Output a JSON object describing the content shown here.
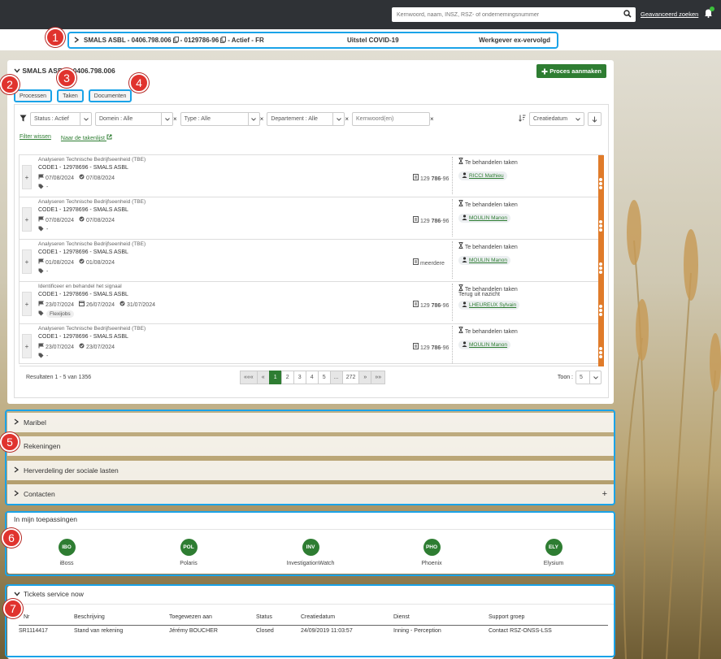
{
  "topbar": {
    "search_placeholder": "Kernwoord, naam, INSZ, RSZ- of ondernemingsnummer",
    "advanced_search": "Geavanceerd zoeken"
  },
  "context": {
    "company": "SMALS ASBL - 0406.798.006",
    "number": "- 0129786-96",
    "state": "- Actief - FR",
    "middle": "Uitstel COVID-19",
    "right": "Werkgever ex-vervolgd"
  },
  "main": {
    "title": "SMALS ASBL - 0406.798.006",
    "create_button": "Proces aanmaken",
    "tabs": [
      {
        "label": "Processen"
      },
      {
        "label": "Taken"
      },
      {
        "label": "Documenten"
      }
    ],
    "filters": {
      "status": "Status : Actief",
      "domain": "Domein : Alle",
      "type": "Type : Alle",
      "department": "Departement : Alle",
      "keyword_placeholder": "Kernwoord(en)",
      "sort": "Creatiedatum"
    },
    "links": {
      "clear": "Filter wissen",
      "tasklist": "Naar de takenlijst"
    },
    "rows": [
      {
        "category": "Analyseren Technische Bedrijfseenheid (TBE)",
        "code": "CODE1 - 12978696 - SMALS ASBL",
        "d1": "07/08/2024",
        "d2": "",
        "d3": "07/08/2024",
        "tag": "-",
        "ref_pre": "129",
        "ref_bold": "786",
        "ref_post": "-96",
        "status": "Te behandelen taken",
        "status2": "",
        "person": "RICCI Mathieu"
      },
      {
        "category": "Analyseren Technische Bedrijfseenheid (TBE)",
        "code": "CODE1 - 12978696 - SMALS ASBL",
        "d1": "07/08/2024",
        "d2": "",
        "d3": "07/08/2024",
        "tag": "-",
        "ref_pre": "129",
        "ref_bold": "786",
        "ref_post": "-96",
        "status": "Te behandelen taken",
        "status2": "",
        "person": "MOULIN Manon"
      },
      {
        "category": "Analyseren Technische Bedrijfseenheid (TBE)",
        "code": "CODE1 - 12978696 - SMALS ASBL",
        "d1": "01/08/2024",
        "d2": "",
        "d3": "01/08/2024",
        "tag": "-",
        "ref_pre": "",
        "ref_bold": "",
        "ref_post": "meerdere",
        "status": "Te behandelen taken",
        "status2": "",
        "person": "MOULIN Manon"
      },
      {
        "category": "Identificeer en behandel het signaal",
        "code": "CODE1 - 12978696 - SMALS ASBL",
        "d1": "23/07/2024",
        "d2": "26/07/2024",
        "d3": "31/07/2024",
        "tag": "Flexijobs",
        "ref_pre": "129",
        "ref_bold": "786",
        "ref_post": "-96",
        "status": "Te behandelen taken",
        "status2": "Terug uit nazicht",
        "person": "LHEUREUX Sylvain"
      },
      {
        "category": "Analyseren Technische Bedrijfseenheid (TBE)",
        "code": "CODE1 - 12978696 - SMALS ASBL",
        "d1": "23/07/2024",
        "d2": "",
        "d3": "23/07/2024",
        "tag": "-",
        "ref_pre": "129",
        "ref_bold": "786",
        "ref_post": "-96",
        "status": "Te behandelen taken",
        "status2": "",
        "person": "MOULIN Manon"
      }
    ],
    "results": "Resultaten 1 - 5 van 1356",
    "pager": [
      "«««",
      "«",
      "1",
      "2",
      "3",
      "4",
      "5",
      "...",
      "272",
      "»",
      "»»"
    ],
    "show_label": "Toon :",
    "show_value": "5"
  },
  "sections": [
    {
      "label": "Maribel"
    },
    {
      "label": "Rekeningen"
    },
    {
      "label": "Herverdeling der sociale lasten"
    },
    {
      "label": "Contacten"
    }
  ],
  "apps": {
    "title": "In mijn toepassingen",
    "items": [
      {
        "code": "IBO",
        "name": "iBoss"
      },
      {
        "code": "POL",
        "name": "Polaris"
      },
      {
        "code": "INV",
        "name": "InvestigationWatch"
      },
      {
        "code": "PHO",
        "name": "Phoenix"
      },
      {
        "code": "ELY",
        "name": "Elysium"
      }
    ]
  },
  "tickets": {
    "title": "Tickets service now",
    "headers": [
      "Nr",
      "Beschrijving",
      "Toegewezen aan",
      "Status",
      "Creatiedatum",
      "Dienst",
      "Support groep"
    ],
    "rows": [
      [
        "SR1114417",
        "Stand van rekening",
        "Jérémy BOUCHER",
        "Closed",
        "24/09/2019 11:03:57",
        "Inning - Perception",
        "Contact RSZ-ONSS-LSS"
      ]
    ]
  },
  "badges": [
    "1",
    "2",
    "3",
    "4",
    "5",
    "6",
    "7"
  ],
  "colors": {
    "accent": "#2e7d32",
    "highlight": "#1aa3e8",
    "badge": "#e0332e",
    "stripe": "#e07b2a"
  }
}
